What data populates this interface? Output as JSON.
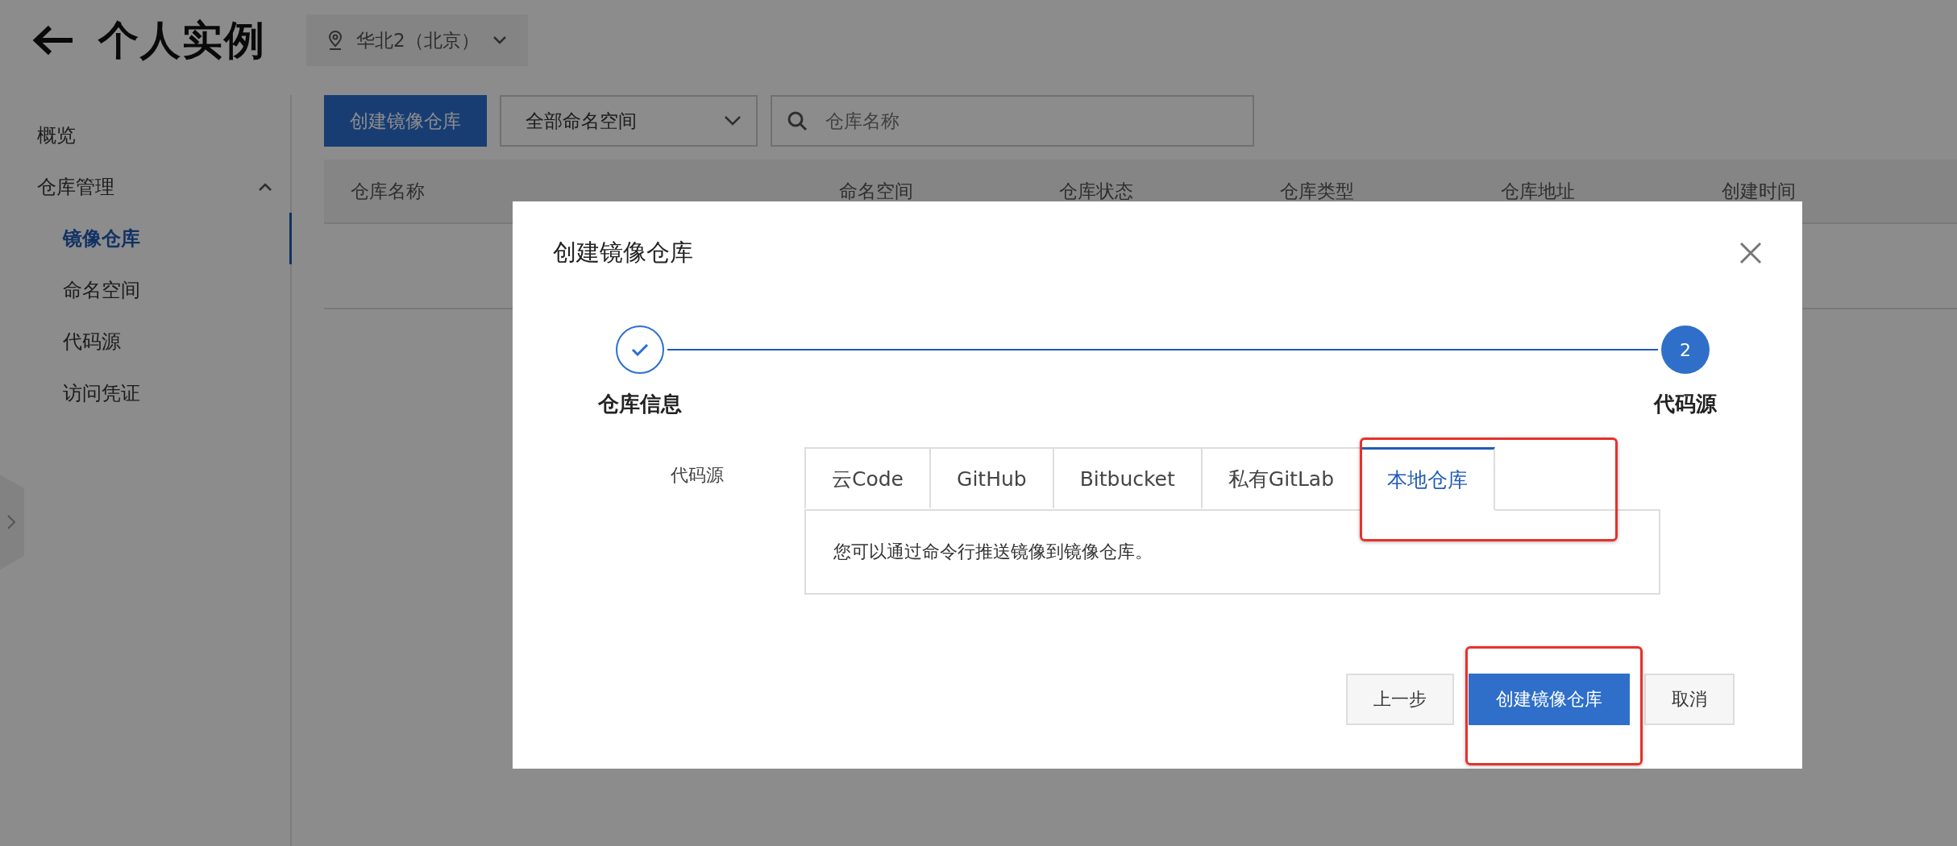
{
  "page": {
    "title": "个人实例",
    "region": "华北2（北京）"
  },
  "sidebar": {
    "items": [
      {
        "label": "概览",
        "selected": false
      },
      {
        "label": "仓库管理",
        "selected": false,
        "expanded": true,
        "children": [
          {
            "label": "镜像仓库",
            "selected": true
          },
          {
            "label": "命名空间",
            "selected": false
          },
          {
            "label": "代码源",
            "selected": false
          },
          {
            "label": "访问凭证",
            "selected": false
          }
        ]
      }
    ]
  },
  "toolbar": {
    "create_button": "创建镜像仓库",
    "namespace_select": "全部命名空间",
    "search": {
      "placeholder": "仓库名称"
    }
  },
  "table": {
    "columns": [
      "仓库名称",
      "命名空间",
      "仓库状态",
      "仓库类型",
      "仓库地址",
      "创建时间"
    ]
  },
  "dialog": {
    "title": "创建镜像仓库",
    "steps": [
      {
        "label": "仓库信息",
        "completed": true
      },
      {
        "label": "代码源",
        "number": "2",
        "completed": false
      }
    ],
    "field_label": "代码源",
    "tabs": [
      {
        "label": "云Code",
        "selected": false,
        "highlighted": false
      },
      {
        "label": "GitHub",
        "selected": false,
        "highlighted": false
      },
      {
        "label": "Bitbucket",
        "selected": false,
        "highlighted": false
      },
      {
        "label": "私有GitLab",
        "selected": false,
        "highlighted": false
      },
      {
        "label": "本地仓库",
        "selected": true,
        "highlighted": true
      }
    ],
    "tab_content": "您可以通过命令行推送镜像到镜像仓库。",
    "buttons": [
      {
        "label": "上一步",
        "kind": "default",
        "highlighted": false
      },
      {
        "label": "创建镜像仓库",
        "kind": "primary",
        "highlighted": true
      },
      {
        "label": "取消",
        "kind": "default",
        "highlighted": false
      }
    ]
  }
}
